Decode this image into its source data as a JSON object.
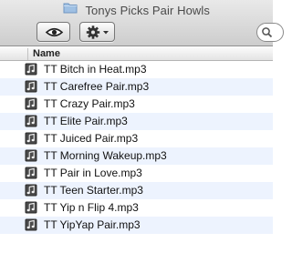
{
  "window": {
    "title": "Tonys Picks Pair Howls"
  },
  "toolbar": {
    "quicklook_icon": "eye-icon",
    "action_icon": "gear-icon",
    "action_menu_icon": "triangle-down-icon"
  },
  "list": {
    "column_name": "Name",
    "files": [
      "TT Bitch in Heat.mp3",
      "TT Carefree Pair.mp3",
      "TT Crazy Pair.mp3",
      "TT Elite Pair.mp3",
      "TT Juiced Pair.mp3",
      "TT Morning Wakeup.mp3",
      "TT Pair in Love.mp3",
      "TT Teen Starter.mp3",
      "TT Yip n Flip 4.mp3",
      "TT YipYap Pair.mp3"
    ]
  }
}
